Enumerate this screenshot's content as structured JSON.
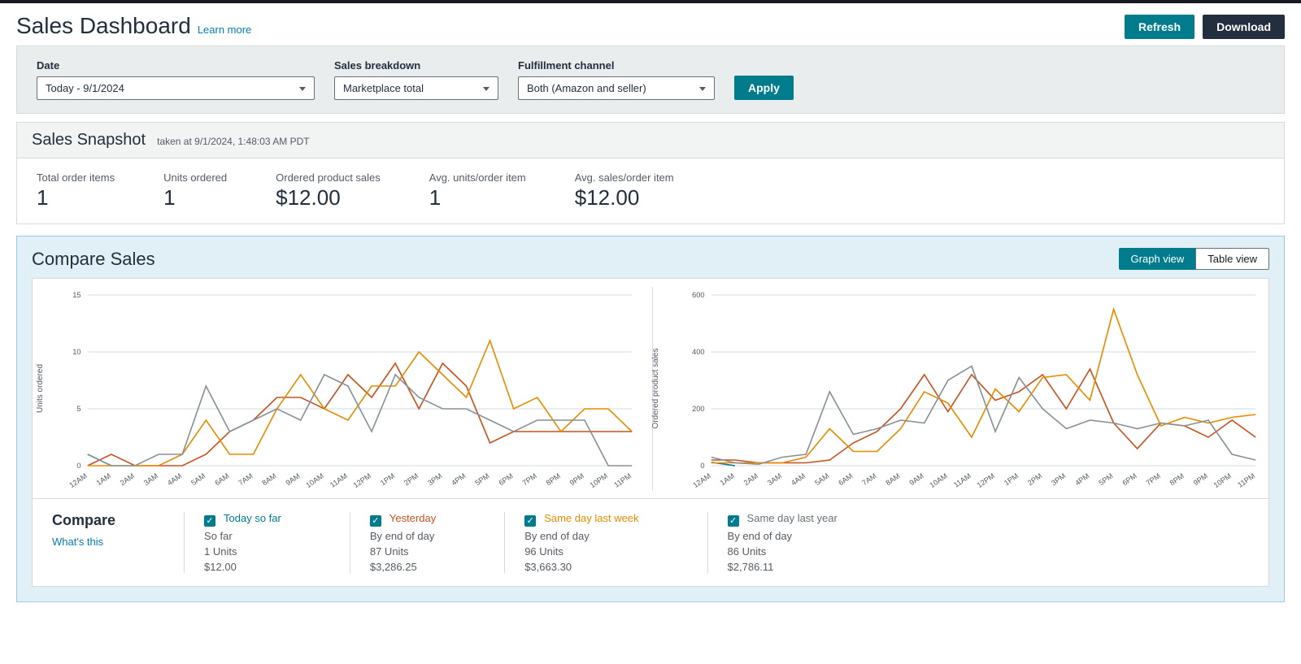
{
  "header": {
    "title": "Sales Dashboard",
    "learn_more": "Learn more",
    "refresh": "Refresh",
    "download": "Download"
  },
  "filters": {
    "date_label": "Date",
    "date_value": "Today - 9/1/2024",
    "breakdown_label": "Sales breakdown",
    "breakdown_value": "Marketplace total",
    "channel_label": "Fulfillment channel",
    "channel_value": "Both (Amazon and seller)",
    "apply": "Apply"
  },
  "snapshot": {
    "title": "Sales Snapshot",
    "taken_at": "taken at 9/1/2024, 1:48:03 AM PDT",
    "metrics": [
      {
        "label": "Total order items",
        "value": "1"
      },
      {
        "label": "Units ordered",
        "value": "1"
      },
      {
        "label": "Ordered product sales",
        "value": "$12.00"
      },
      {
        "label": "Avg. units/order item",
        "value": "1"
      },
      {
        "label": "Avg. sales/order item",
        "value": "$12.00"
      }
    ]
  },
  "compare": {
    "title": "Compare Sales",
    "graph_view": "Graph view",
    "table_view": "Table view",
    "compare_label": "Compare",
    "whats_this": "What's this",
    "series": [
      {
        "key": "today",
        "name": "Today so far",
        "sub": "So far",
        "units": "1 Units",
        "sales": "$12.00"
      },
      {
        "key": "yest",
        "name": "Yesterday",
        "sub": "By end of day",
        "units": "87 Units",
        "sales": "$3,286.25"
      },
      {
        "key": "lastweek",
        "name": "Same day last week",
        "sub": "By end of day",
        "units": "96 Units",
        "sales": "$3,663.30"
      },
      {
        "key": "lastyear",
        "name": "Same day last year",
        "sub": "By end of day",
        "units": "86 Units",
        "sales": "$2,786.11"
      }
    ]
  },
  "chart_data": [
    {
      "type": "line",
      "title": "",
      "ylabel": "Units ordered",
      "ylim": [
        0,
        15
      ],
      "yticks": [
        0,
        5,
        10,
        15
      ],
      "categories": [
        "12AM",
        "1AM",
        "2AM",
        "3AM",
        "4AM",
        "5AM",
        "6AM",
        "7AM",
        "8AM",
        "9AM",
        "10AM",
        "11AM",
        "12PM",
        "1PM",
        "2PM",
        "3PM",
        "4PM",
        "5PM",
        "6PM",
        "7PM",
        "8PM",
        "9PM",
        "10PM",
        "11PM"
      ],
      "series": [
        {
          "name": "Today so far",
          "color": "#007c8c",
          "values": [
            1,
            0
          ]
        },
        {
          "name": "Yesterday",
          "color": "#c7511f",
          "values": [
            0,
            1,
            0,
            0,
            0,
            1,
            3,
            4,
            6,
            6,
            5,
            8,
            6,
            9,
            5,
            9,
            7,
            2,
            3,
            3,
            3,
            3,
            3,
            3
          ]
        },
        {
          "name": "Same day last week",
          "color": "#e88b00",
          "values": [
            0,
            0,
            0,
            0,
            1,
            4,
            1,
            1,
            5,
            8,
            5,
            4,
            7,
            7,
            10,
            8,
            6,
            11,
            5,
            6,
            3,
            5,
            5,
            3
          ]
        },
        {
          "name": "Same day last year",
          "color": "#879196",
          "values": [
            1,
            0,
            0,
            1,
            1,
            7,
            3,
            4,
            5,
            4,
            8,
            7,
            3,
            8,
            6,
            5,
            5,
            4,
            3,
            4,
            4,
            4,
            0,
            0
          ]
        }
      ]
    },
    {
      "type": "line",
      "title": "",
      "ylabel": "Ordered product sales",
      "ylim": [
        0,
        600
      ],
      "yticks": [
        0,
        200,
        400,
        600
      ],
      "categories": [
        "12AM",
        "1AM",
        "2AM",
        "3AM",
        "4AM",
        "5AM",
        "6AM",
        "7AM",
        "8AM",
        "9AM",
        "10AM",
        "11AM",
        "12PM",
        "1PM",
        "2PM",
        "3PM",
        "4PM",
        "5PM",
        "6PM",
        "7PM",
        "8PM",
        "9PM",
        "10PM",
        "11PM"
      ],
      "series": [
        {
          "name": "Today so far",
          "color": "#007c8c",
          "values": [
            12,
            0
          ]
        },
        {
          "name": "Yesterday",
          "color": "#c7511f",
          "values": [
            20,
            20,
            10,
            10,
            10,
            20,
            80,
            120,
            200,
            320,
            190,
            320,
            230,
            260,
            320,
            200,
            340,
            150,
            60,
            150,
            140,
            100,
            160,
            100
          ]
        },
        {
          "name": "Same day last week",
          "color": "#e88b00",
          "values": [
            10,
            10,
            10,
            10,
            30,
            130,
            50,
            50,
            130,
            260,
            220,
            100,
            270,
            190,
            310,
            320,
            230,
            550,
            320,
            140,
            170,
            150,
            170,
            180
          ]
        },
        {
          "name": "Same day last year",
          "color": "#879196",
          "values": [
            30,
            10,
            5,
            30,
            40,
            260,
            110,
            130,
            160,
            150,
            300,
            350,
            120,
            310,
            200,
            130,
            160,
            150,
            130,
            150,
            140,
            160,
            40,
            20
          ]
        }
      ]
    }
  ]
}
